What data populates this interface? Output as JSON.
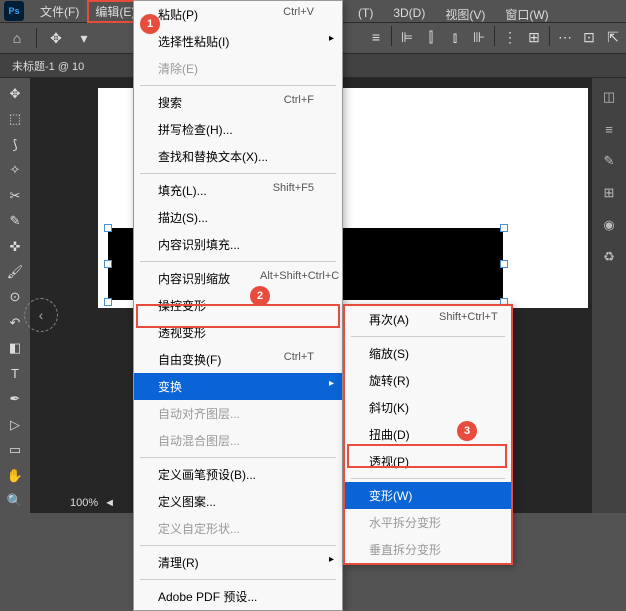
{
  "menubar": {
    "file": "文件(F)",
    "edit": "编辑(E)",
    "rest": [
      "(T)",
      "3D(D)",
      "视图(V)",
      "窗口(W)"
    ]
  },
  "doc_tab": "未标题-1 @ 10",
  "zoom": "100%",
  "edit_menu": {
    "paste": {
      "label": "粘贴(P)",
      "shortcut": "Ctrl+V"
    },
    "paste_special": {
      "label": "选择性粘贴(I)"
    },
    "clear": {
      "label": "清除(E)"
    },
    "search": {
      "label": "搜索",
      "shortcut": "Ctrl+F"
    },
    "spell": {
      "label": "拼写检查(H)..."
    },
    "find_replace": {
      "label": "查找和替换文本(X)..."
    },
    "fill": {
      "label": "填充(L)...",
      "shortcut": "Shift+F5"
    },
    "stroke": {
      "label": "描边(S)..."
    },
    "content_fill": {
      "label": "内容识别填充..."
    },
    "content_scale": {
      "label": "内容识别缩放",
      "shortcut": "Alt+Shift+Ctrl+C"
    },
    "puppet": {
      "label": "操控变形"
    },
    "perspective": {
      "label": "透视变形"
    },
    "free_transform": {
      "label": "自由变换(F)",
      "shortcut": "Ctrl+T"
    },
    "transform": {
      "label": "变换"
    },
    "auto_align": {
      "label": "自动对齐图层..."
    },
    "auto_blend": {
      "label": "自动混合图层..."
    },
    "brush_preset": {
      "label": "定义画笔预设(B)..."
    },
    "pattern": {
      "label": "定义图案..."
    },
    "shape": {
      "label": "定义自定形状..."
    },
    "purge": {
      "label": "清理(R)"
    },
    "pdf": {
      "label": "Adobe PDF 预设..."
    }
  },
  "transform_submenu": {
    "again": {
      "label": "再次(A)",
      "shortcut": "Shift+Ctrl+T"
    },
    "scale": {
      "label": "缩放(S)"
    },
    "rotate": {
      "label": "旋转(R)"
    },
    "skew": {
      "label": "斜切(K)"
    },
    "distort": {
      "label": "扭曲(D)"
    },
    "perspective": {
      "label": "透视(P)"
    },
    "warp": {
      "label": "变形(W)"
    },
    "h_split": {
      "label": "水平拆分变形"
    },
    "v_split": {
      "label": "垂直拆分变形"
    }
  },
  "badges": {
    "b1": "1",
    "b2": "2",
    "b3": "3"
  }
}
